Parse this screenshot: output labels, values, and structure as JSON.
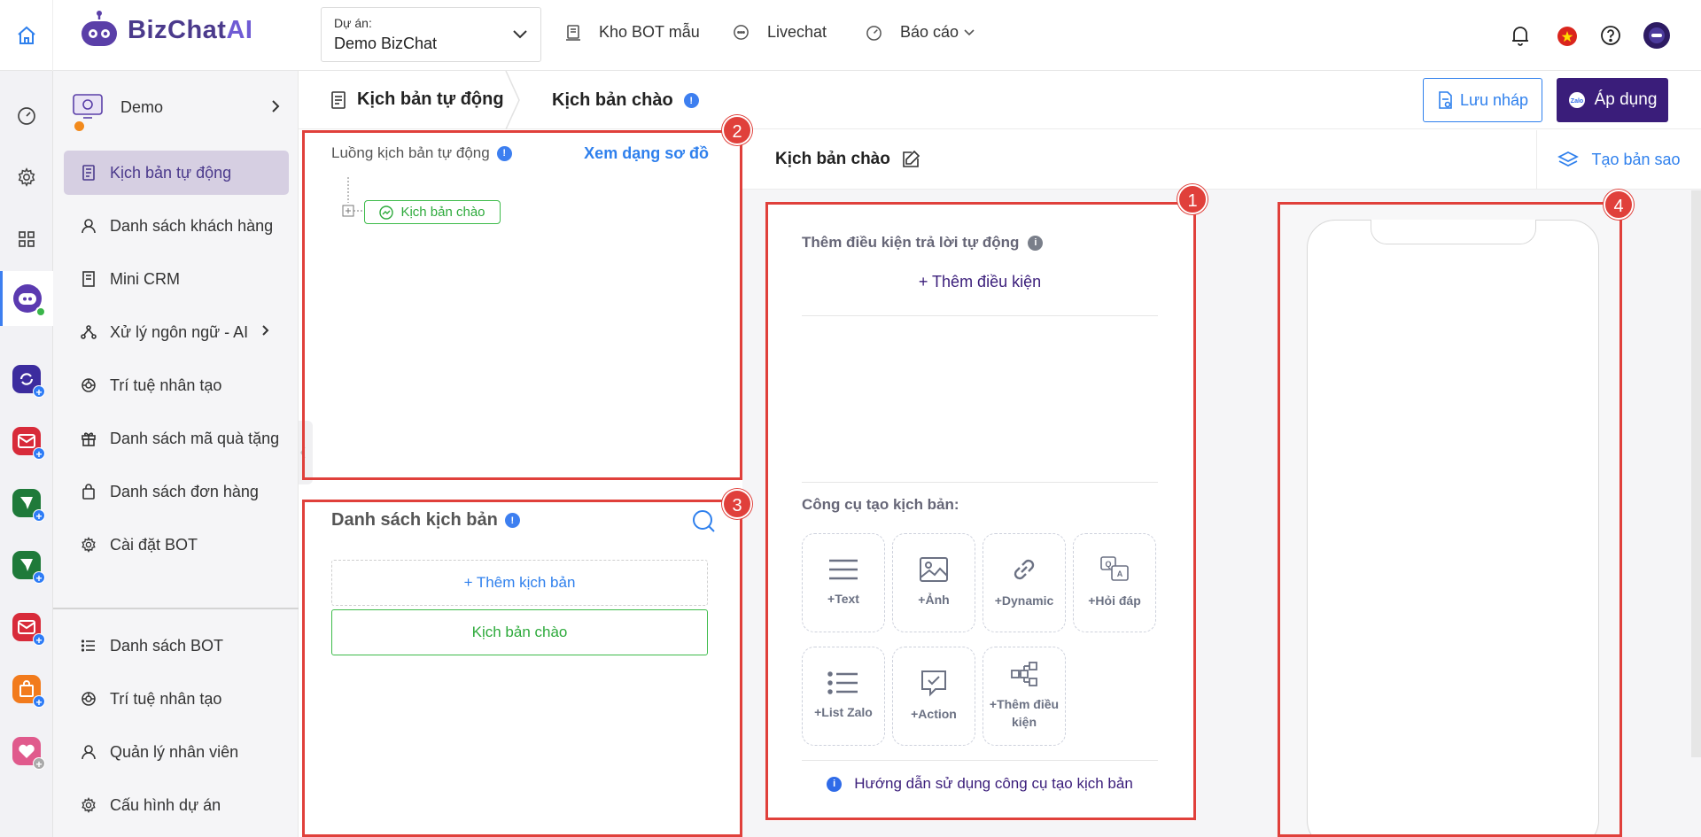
{
  "topbar": {
    "brand": "BizChatAI",
    "project_caption": "Dự án:",
    "project_name": "Demo BizChat",
    "nav": [
      {
        "label": "Kho BOT mẫu",
        "icon": "template-icon"
      },
      {
        "label": "Livechat",
        "icon": "chat-icon"
      },
      {
        "label": "Báo cáo",
        "icon": "dashboard-icon"
      }
    ]
  },
  "sidemenu": {
    "bot_name": "Demo",
    "items": [
      {
        "label": "Kịch bản tự động",
        "active": true
      },
      {
        "label": "Danh sách khách hàng"
      },
      {
        "label": "Mini CRM"
      },
      {
        "label": "Xử lý ngôn ngữ - AI"
      },
      {
        "label": "Trí tuệ nhân tạo"
      },
      {
        "label": "Danh sách mã quà tặng"
      },
      {
        "label": "Danh sách đơn hàng"
      },
      {
        "label": "Cài đặt BOT"
      }
    ],
    "bottom_items": [
      {
        "label": "Danh sách BOT"
      },
      {
        "label": "Trí tuệ nhân tạo"
      },
      {
        "label": "Quản lý nhân viên"
      },
      {
        "label": "Cấu hình dự án"
      }
    ]
  },
  "header": {
    "tab1": "Kịch bản tự động",
    "tab2": "Kịch bản chào",
    "draft_label": "Lưu nháp",
    "apply_label": "Áp dụng"
  },
  "flow": {
    "title": "Luồng kịch bản tự động",
    "diagram_link": "Xem dạng sơ đồ",
    "node_label": "Kịch bản chào"
  },
  "script_list": {
    "title": "Danh sách kịch bản",
    "add_label": "+ Thêm kịch bản",
    "items": [
      "Kịch bản chào"
    ]
  },
  "editor": {
    "title": "Kịch bản chào",
    "copy_label": "Tạo bản sao",
    "cond_title": "Thêm điều kiện trả lời tự động",
    "add_cond": "+ Thêm điều kiện",
    "tools_title": "Công cụ tạo kịch bản:",
    "tools": [
      "+Text",
      "+Ảnh",
      "+Dynamic",
      "+Hỏi đáp",
      "+List Zalo",
      "+Action",
      "+Thêm điều kiện"
    ],
    "guide": "Hướng dẫn sử dụng công cụ tạo kịch bản"
  },
  "annotations": [
    "1",
    "2",
    "3",
    "4"
  ],
  "colors": {
    "brand": "#3a1d7a",
    "accent_blue": "#2f80ed",
    "active_menu_bg": "#d6cfe2",
    "green": "#3dbb4a",
    "annotation_red": "#e0403b"
  }
}
